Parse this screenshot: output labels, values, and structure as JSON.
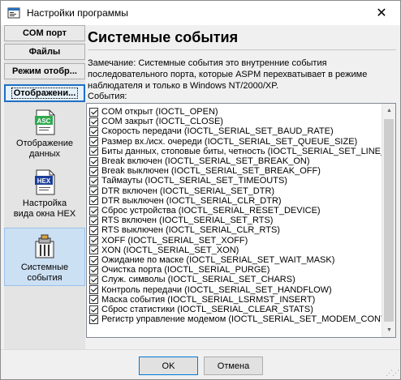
{
  "window": {
    "title": "Настройки программы",
    "close_glyph": "✕"
  },
  "tabs": [
    {
      "label": "COM порт"
    },
    {
      "label": "Файлы"
    },
    {
      "label": "Режим отобр..."
    },
    {
      "label": "Отображени..."
    }
  ],
  "nav": [
    {
      "label_lines": [
        "Отображение",
        "данных"
      ],
      "icon": "asc-icon",
      "badge": "ASC"
    },
    {
      "label_lines": [
        "Настройка",
        "вида окна HEX"
      ],
      "icon": "hex-icon",
      "badge": "HEX"
    },
    {
      "label_lines": [
        "Системные",
        "события"
      ],
      "icon": "system-events-icon"
    }
  ],
  "main": {
    "title": "Системные события",
    "note": "Замечание: Системные события это внутренние события последовательного порта, которые ASPM перехватывает в режиме наблюдателя и только в Windows NT/2000/XP.",
    "events_label": "События:",
    "events": [
      {
        "text": "COM открыт (IOCTL_OPEN)",
        "checked": true
      },
      {
        "text": "COM закрыт (IOCTL_CLOSE)",
        "checked": true
      },
      {
        "text": "Скорость передачи (IOCTL_SERIAL_SET_BAUD_RATE)",
        "checked": true
      },
      {
        "text": "Размер вх./исх. очереди (IOCTL_SERIAL_SET_QUEUE_SIZE)",
        "checked": true
      },
      {
        "text": "Биты данных, стоповые биты, четность (IOCTL_SERIAL_SET_LINE_C",
        "checked": true
      },
      {
        "text": "Break включен (IOCTL_SERIAL_SET_BREAK_ON)",
        "checked": true
      },
      {
        "text": "Break выключен (IOCTL_SERIAL_SET_BREAK_OFF)",
        "checked": true
      },
      {
        "text": "Таймауты (IOCTL_SERIAL_SET_TIMEOUTS)",
        "checked": true
      },
      {
        "text": "DTR включен (IOCTL_SERIAL_SET_DTR)",
        "checked": true
      },
      {
        "text": "DTR выключен (IOCTL_SERIAL_CLR_DTR)",
        "checked": true
      },
      {
        "text": "Сброс устройства (IOCTL_SERIAL_RESET_DEVICE)",
        "checked": true
      },
      {
        "text": "RTS включен (IOCTL_SERIAL_SET_RTS)",
        "checked": true
      },
      {
        "text": "RTS выключен (IOCTL_SERIAL_CLR_RTS)",
        "checked": true
      },
      {
        "text": "XOFF (IOCTL_SERIAL_SET_XOFF)",
        "checked": true
      },
      {
        "text": "XON (IOCTL_SERIAL_SET_XON)",
        "checked": true
      },
      {
        "text": "Ожидание по маске (IOCTL_SERIAL_SET_WAIT_MASK)",
        "checked": true
      },
      {
        "text": "Очистка порта (IOCTL_SERIAL_PURGE)",
        "checked": true
      },
      {
        "text": "Служ. символы (IOCTL_SERIAL_SET_CHARS)",
        "checked": true
      },
      {
        "text": "Контроль передачи (IOCTL_SERIAL_SET_HANDFLOW)",
        "checked": true
      },
      {
        "text": "Маска события (IOCTL_SERIAL_LSRMST_INSERT)",
        "checked": true
      },
      {
        "text": "Сброс статистики (IOCTL_SERIAL_CLEAR_STATS)",
        "checked": true
      },
      {
        "text": "Регистр управление модемом (IOCTL_SERIAL_SET_MODEM_CONT",
        "checked": true
      }
    ]
  },
  "buttons": {
    "ok": "OK",
    "cancel": "Отмена"
  },
  "colors": {
    "accent": "#0078d7",
    "selected_bg": "#cce0f4",
    "active_tab_border": "#1e6fc4"
  }
}
